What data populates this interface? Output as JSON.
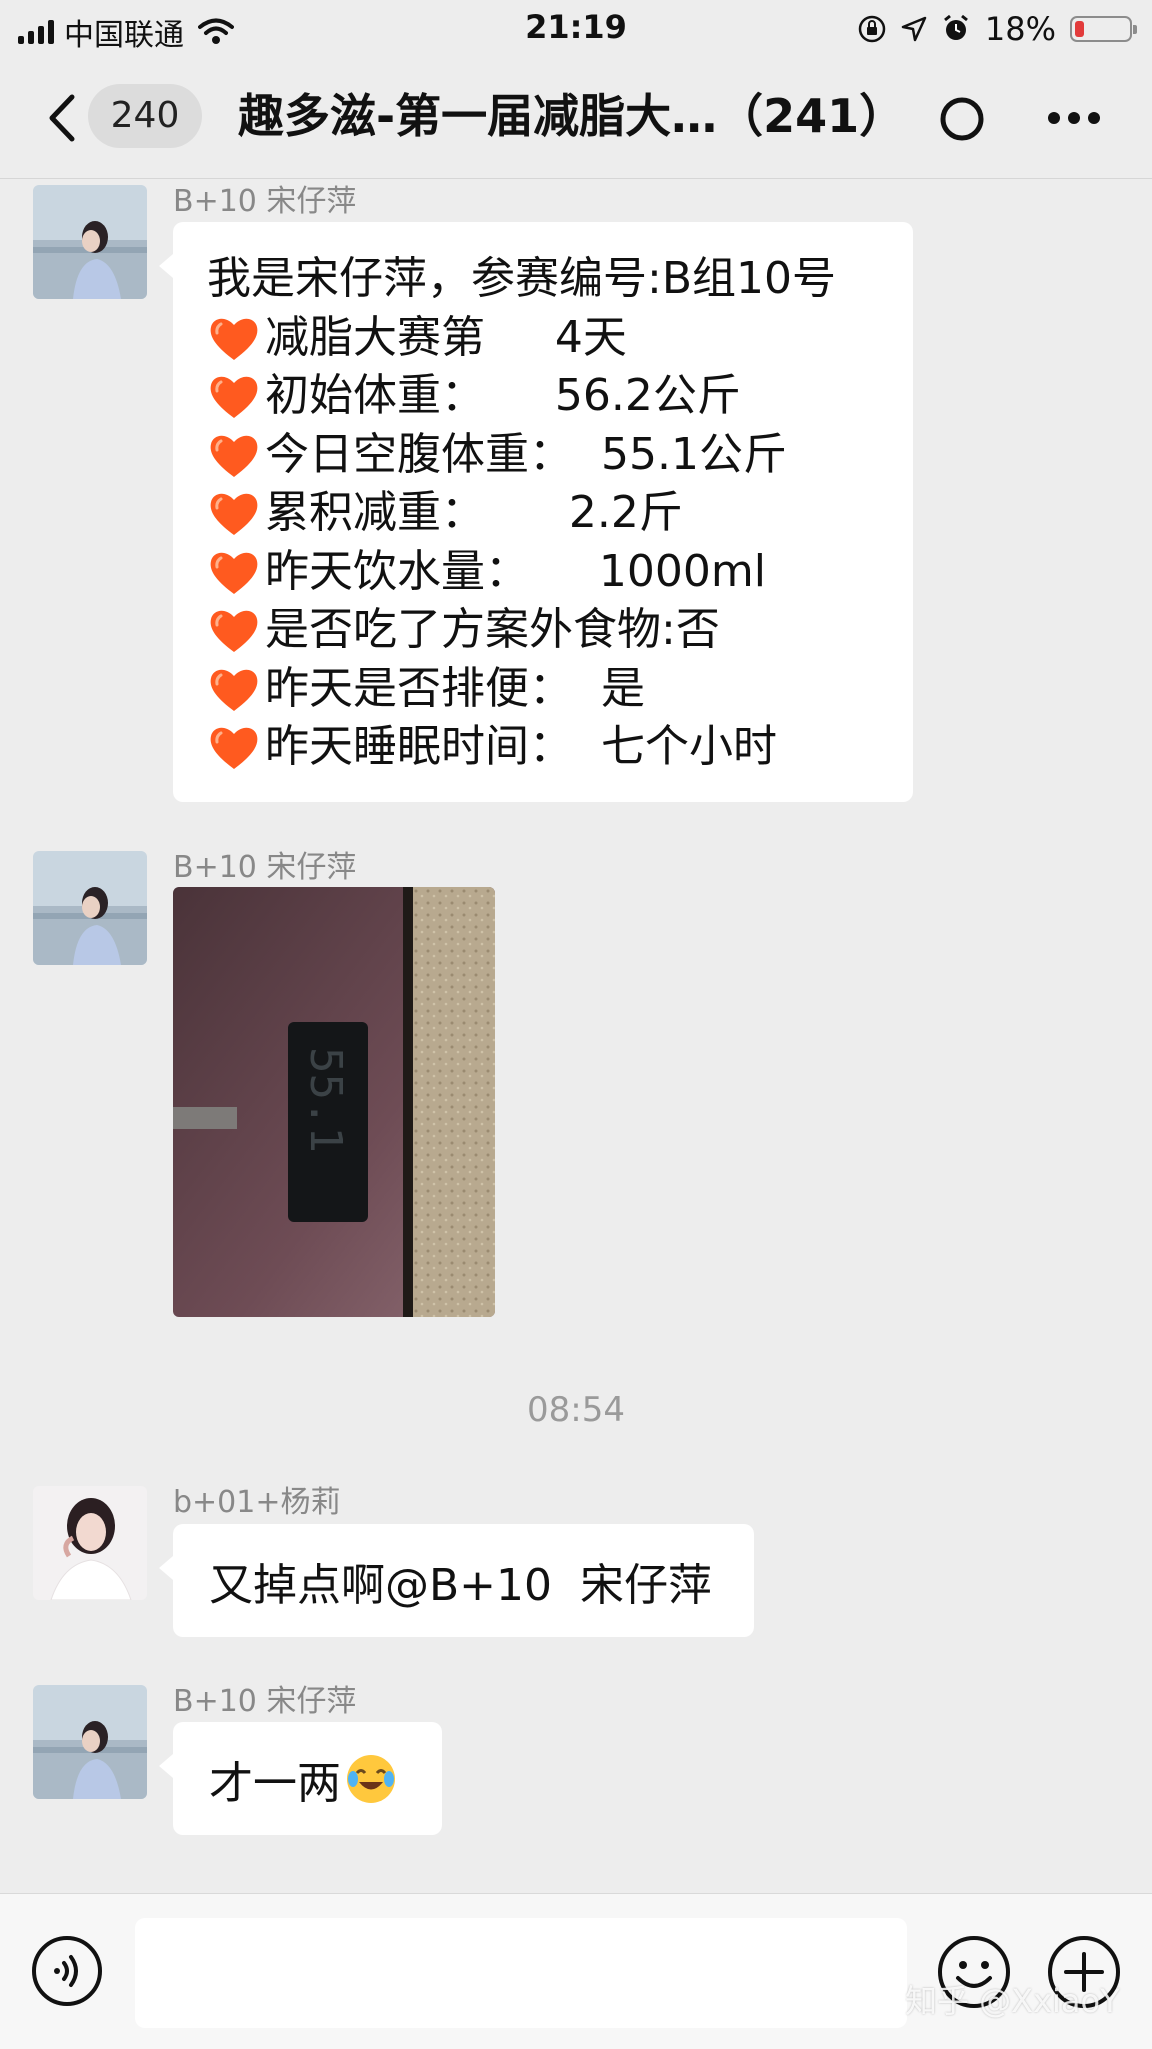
{
  "status_bar": {
    "carrier": "中国联通",
    "time": "21:19",
    "battery": "18%",
    "battery_level": 0.18
  },
  "nav": {
    "unread_count": "240",
    "title": "趣多滋-第一届减脂大…（241）"
  },
  "messages": [
    {
      "sender": "B+10  宋仔萍",
      "lines": [
        {
          "heart": false,
          "text": "我是宋仔萍，参赛编号:B组10号"
        },
        {
          "heart": true,
          "text": "减脂大赛第     4天"
        },
        {
          "heart": true,
          "text": "初始体重：     56.2公斤"
        },
        {
          "heart": true,
          "text": "今日空腹体重：  55.1公斤"
        },
        {
          "heart": true,
          "text": "累积减重：      2.2斤"
        },
        {
          "heart": true,
          "text": "昨天饮水量：     1000ml"
        },
        {
          "heart": true,
          "text": "是否吃了方案外食物:否"
        },
        {
          "heart": true,
          "text": "昨天是否排便：  是"
        },
        {
          "heart": true,
          "text": "昨天睡眠时间：  七个小时"
        }
      ]
    },
    {
      "sender": "B+10  宋仔萍",
      "image_reading": "55.1"
    },
    {
      "sender": "b+01+杨莉",
      "text": "又掉点啊@B+10  宋仔萍"
    },
    {
      "sender": "B+10  宋仔萍",
      "text": "才一两"
    }
  ],
  "timestamp": "08:54",
  "input": {
    "value": ""
  },
  "watermark": "知乎 @XxiaoY",
  "colors": {
    "background": "#ededed",
    "bubble": "#ffffff",
    "heart": "#ff5a1f",
    "battery_low": "#e23b3b"
  }
}
